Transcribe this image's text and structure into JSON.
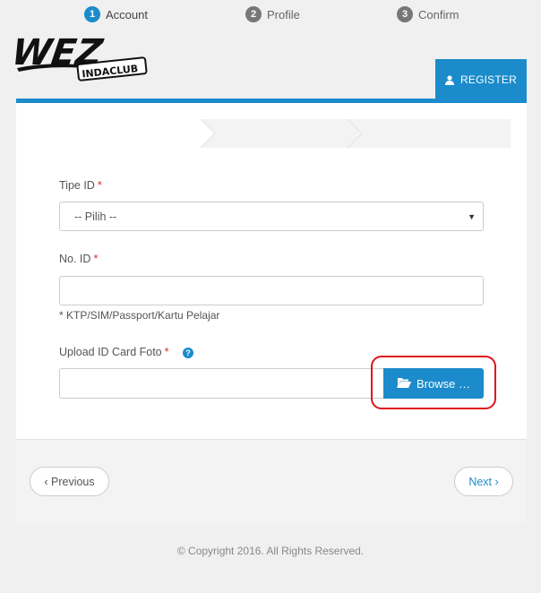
{
  "header": {
    "logo_text": "WEZ INDACLUB",
    "register_label": "REGISTER"
  },
  "steps": [
    {
      "num": "1",
      "label": "Account"
    },
    {
      "num": "2",
      "label": "Profile"
    },
    {
      "num": "3",
      "label": "Confirm"
    }
  ],
  "form": {
    "tipe_id_label": "Tipe ID",
    "tipe_id_value": "-- Pilih --",
    "no_id_label": "No. ID",
    "no_id_value": "",
    "no_id_hint": "* KTP/SIM/Passport/Kartu Pelajar",
    "upload_label": "Upload ID Card Foto",
    "required_marker": "*",
    "help_glyph": "?",
    "browse_label": "Browse …"
  },
  "nav": {
    "previous_label": "‹ Previous",
    "next_label": "Next ›"
  },
  "footer": {
    "copyright": "© Copyright 2016. All Rights Reserved."
  },
  "colors": {
    "accent": "#1b8bcb",
    "highlight": "#e0121c"
  }
}
